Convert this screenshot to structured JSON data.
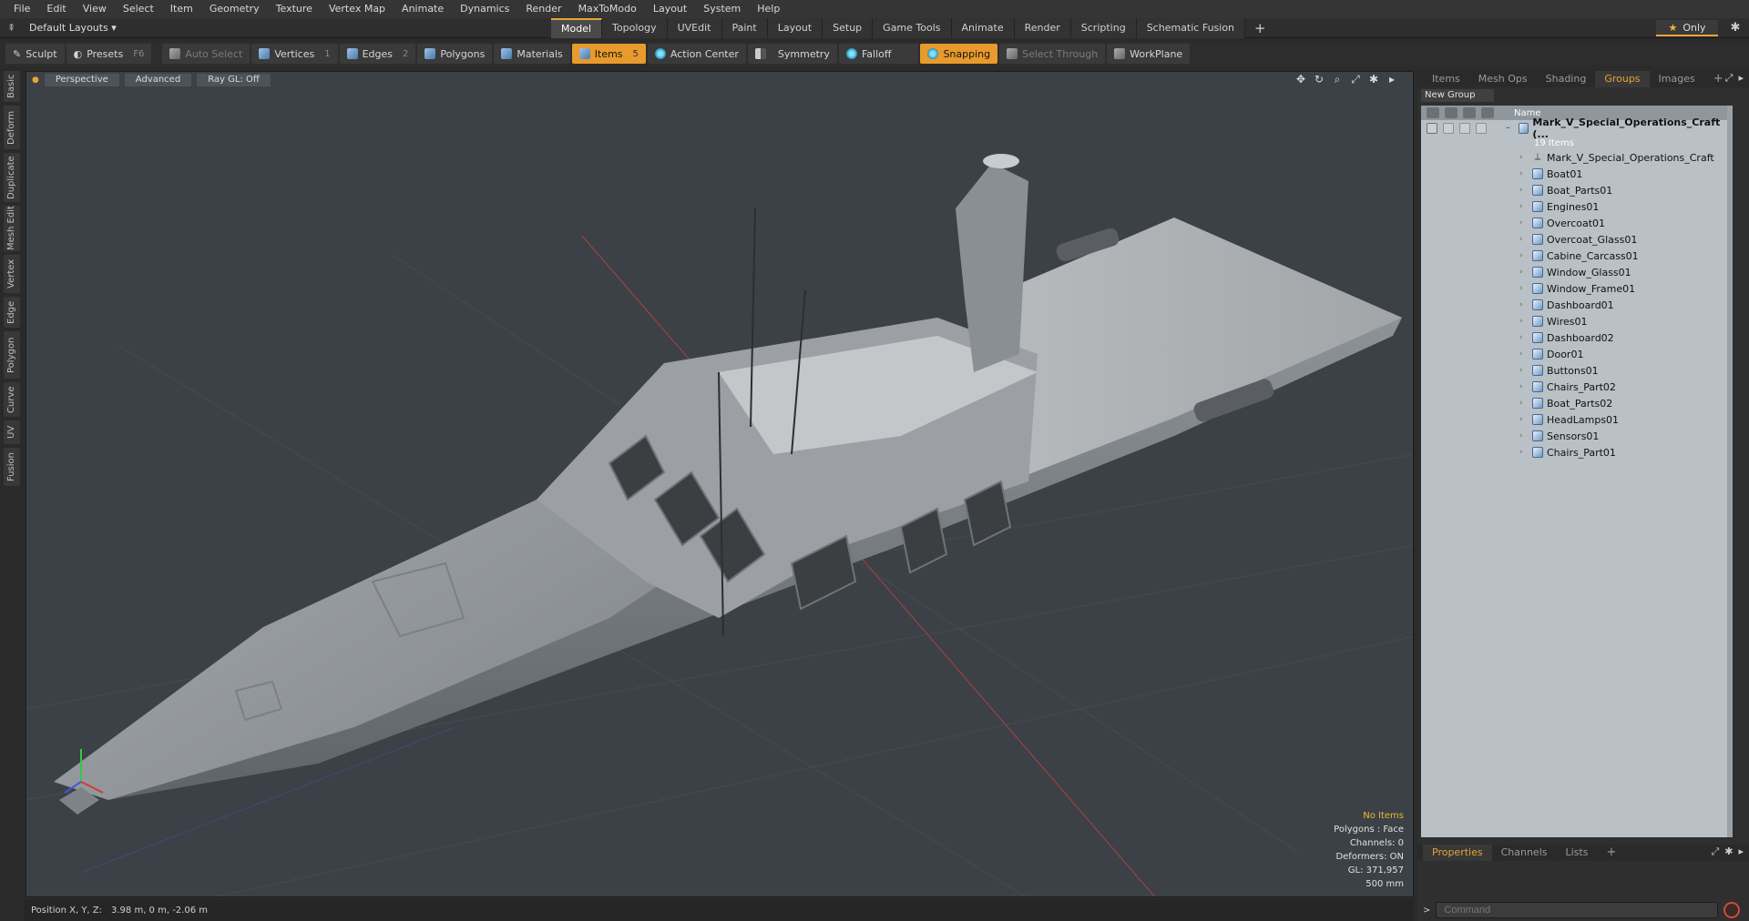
{
  "menu": [
    "File",
    "Edit",
    "View",
    "Select",
    "Item",
    "Geometry",
    "Texture",
    "Vertex Map",
    "Animate",
    "Dynamics",
    "Render",
    "MaxToModo",
    "Layout",
    "System",
    "Help"
  ],
  "layout": {
    "name": "Default Layouts ▾"
  },
  "mode_tabs": [
    {
      "label": "Model",
      "active": true
    },
    {
      "label": "Topology"
    },
    {
      "label": "UVEdit"
    },
    {
      "label": "Paint"
    },
    {
      "label": "Layout"
    },
    {
      "label": "Setup"
    },
    {
      "label": "Game Tools"
    },
    {
      "label": "Animate"
    },
    {
      "label": "Render"
    },
    {
      "label": "Scripting"
    },
    {
      "label": "Schematic Fusion"
    }
  ],
  "mode_plus": "+",
  "only_label": "Only",
  "toolbar": {
    "sculpt": "Sculpt",
    "presets": "Presets",
    "presets_key": "F6",
    "auto_select": "Auto Select",
    "vertices": "Vertices",
    "vertices_key": "1",
    "edges": "Edges",
    "edges_key": "2",
    "polygons": "Polygons",
    "materials": "Materials",
    "items": "Items",
    "items_key": "5",
    "action_center": "Action Center",
    "symmetry": "Symmetry",
    "falloff": "Falloff",
    "snapping": "Snapping",
    "select_through": "Select Through",
    "workplane": "WorkPlane"
  },
  "left_tabs": [
    "Basic",
    "Deform",
    "Duplicate",
    "Mesh Edit",
    "Vertex",
    "Edge",
    "Polygon",
    "Curve",
    "UV",
    "Fusion"
  ],
  "viewport": {
    "view": "Perspective",
    "shading": "Advanced",
    "raygl": "Ray GL: Off",
    "info": {
      "items": "No Items",
      "polygons": "Polygons : Face",
      "channels": "Channels: 0",
      "deformers": "Deformers: ON",
      "gl": "GL: 371,957",
      "scale": "500 mm"
    }
  },
  "status": {
    "label": "Position X, Y, Z:",
    "value": "3.98 m, 0 m, -2.06 m"
  },
  "right_panel": {
    "tabs": [
      {
        "label": "Items"
      },
      {
        "label": "Mesh Ops"
      },
      {
        "label": "Shading"
      },
      {
        "label": "Groups",
        "active": true
      },
      {
        "label": "Images"
      }
    ],
    "tabs_plus": "+",
    "new_group": "New Group",
    "col_name": "Name",
    "group": {
      "name": "Mark_V_Special_Operations_Craft (...",
      "count": "19 Items",
      "items": [
        {
          "name": "Mark_V_Special_Operations_Craft",
          "kind": "locator"
        },
        {
          "name": "Boat01",
          "kind": "mesh"
        },
        {
          "name": "Boat_Parts01",
          "kind": "mesh"
        },
        {
          "name": "Engines01",
          "kind": "mesh"
        },
        {
          "name": "Overcoat01",
          "kind": "mesh"
        },
        {
          "name": "Overcoat_Glass01",
          "kind": "mesh"
        },
        {
          "name": "Cabine_Carcass01",
          "kind": "mesh"
        },
        {
          "name": "Window_Glass01",
          "kind": "mesh"
        },
        {
          "name": "Window_Frame01",
          "kind": "mesh"
        },
        {
          "name": "Dashboard01",
          "kind": "mesh"
        },
        {
          "name": "Wires01",
          "kind": "mesh"
        },
        {
          "name": "Dashboard02",
          "kind": "mesh"
        },
        {
          "name": "Door01",
          "kind": "mesh"
        },
        {
          "name": "Buttons01",
          "kind": "mesh"
        },
        {
          "name": "Chairs_Part02",
          "kind": "mesh"
        },
        {
          "name": "Boat_Parts02",
          "kind": "mesh"
        },
        {
          "name": "HeadLamps01",
          "kind": "mesh"
        },
        {
          "name": "Sensors01",
          "kind": "mesh"
        },
        {
          "name": "Chairs_Part01",
          "kind": "mesh"
        }
      ]
    },
    "bottom_tabs": [
      {
        "label": "Properties",
        "active": true
      },
      {
        "label": "Channels"
      },
      {
        "label": "Lists"
      }
    ],
    "bottom_plus": "+",
    "command_placeholder": "Command"
  },
  "colors": {
    "accent": "#e89a2c",
    "viewport_bg": "#3b4146",
    "groups_bg": "#b9c0c6"
  }
}
